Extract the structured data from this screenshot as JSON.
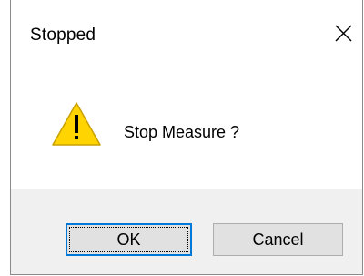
{
  "dialog": {
    "title": "Stopped",
    "message": "Stop Measure ?",
    "icon": "warning-icon",
    "buttons": {
      "ok_label": "OK",
      "cancel_label": "Cancel"
    }
  },
  "colors": {
    "warning_fill": "#FFD400",
    "warning_stroke": "#C8A000",
    "focus_border": "#0078D7",
    "footer_bg": "#F0F0F0"
  }
}
